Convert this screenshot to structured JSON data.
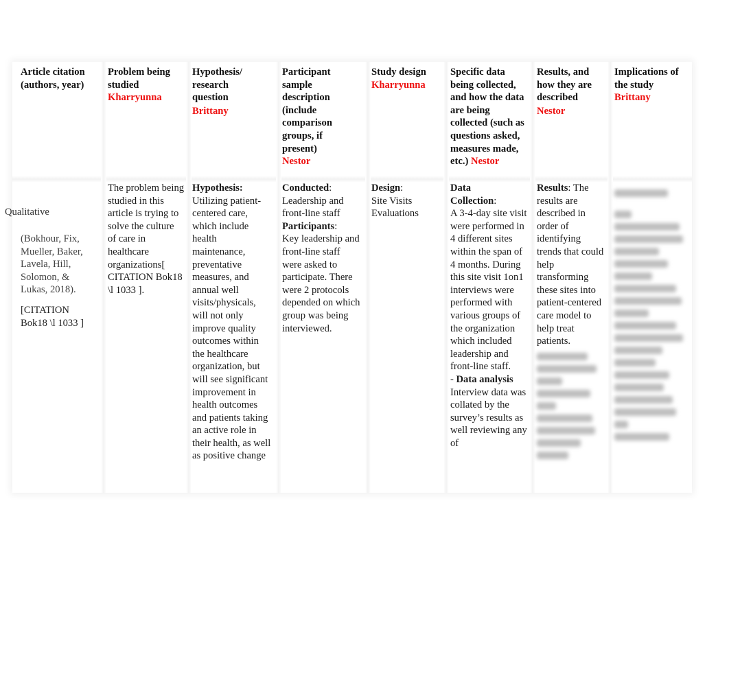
{
  "document": {
    "side_label": "Qualitative",
    "headers": [
      {
        "title": "Article citation (authors, year)",
        "assignee": ""
      },
      {
        "title": "Problem being studied",
        "assignee": "Kharryunna"
      },
      {
        "title": "Hypothesis/ research question",
        "assignee": "Brittany"
      },
      {
        "title": "Participant sample description (include comparison groups, if present)",
        "assignee": "Nestor"
      },
      {
        "title": "Study design",
        "assignee": "Kharryunna"
      },
      {
        "title": "Specific data being collected, and how the data are being collected (such as questions asked, measures made, etc.)",
        "assignee": "Nestor"
      },
      {
        "title": "Results, and how they are described",
        "assignee": "Nestor"
      },
      {
        "title": "Implications of the study",
        "assignee": "Brittany"
      }
    ],
    "row": {
      "citation": {
        "authors": "(Bokhour, Fix, Mueller, Baker, Lavela, Hill, Solomon, & Lukas, 2018).",
        "field_code": "[CITATION Bok18 \\l 1033 ]"
      },
      "problem": {
        "text": "The problem being studied in this article is trying to solve the culture of care in healthcare organizations[ CITATION Bok18 \\l 1033 ]."
      },
      "hypothesis": {
        "label": "Hypothesis:",
        "text": "Utilizing patient-centered care, which include health maintenance, preventative measures, and annual well visits/physicals, will not only improve quality outcomes within the healthcare organization, but will see significant improvement in health outcomes and patients taking an active role in their health, as well as positive change"
      },
      "participants": {
        "conducted_label": "Conducted",
        "conducted_text": "Leadership and front-line staff",
        "participants_label": "Participants",
        "participants_text": "Key leadership and front-line staff were asked to participate. There were 2 protocols depended on which group was being interviewed."
      },
      "design": {
        "label": "Design",
        "text": "Site Visits Evaluations"
      },
      "data_collection": {
        "label": "Data Collection",
        "text": "A 3-4-day site visit were performed in 4 different sites within the span of 4 months. During this site visit 1on1 interviews were performed with various groups of the organization which included leadership and front-line staff.",
        "analysis_prefix": "- ",
        "analysis_label": "Data analysis",
        "analysis_text": "Interview data was collated by the survey’s results as well reviewing any of"
      },
      "results": {
        "label": "Results",
        "text": "The results are described in order of identifying trends that could help transforming these sites into patient-centered care model to help treat patients.",
        "blurred_note": "(remaining text obscured)"
      },
      "implications": {
        "blurred_note": "(text obscured)"
      }
    }
  }
}
